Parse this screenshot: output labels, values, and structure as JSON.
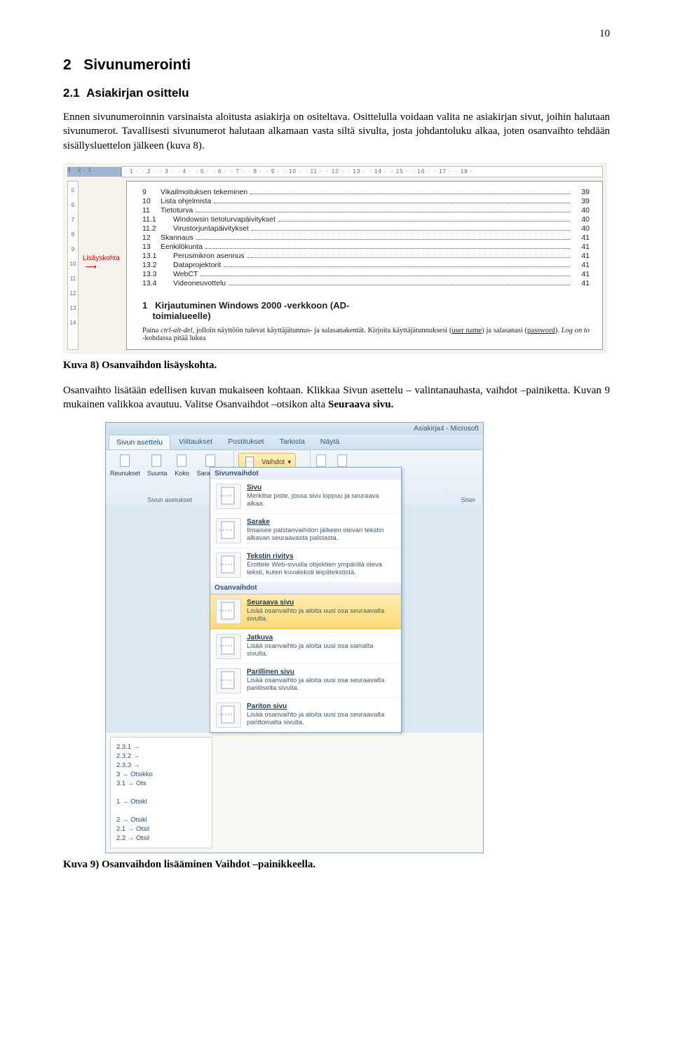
{
  "page_number": "10",
  "h1_num": "2",
  "h1_text": "Sivunumerointi",
  "h2_num": "2.1",
  "h2_text": "Asiakirjan osittelu",
  "p1_a": "Ennen sivunumeroinnin varsinaista aloitusta asiakirja on ositeltava. Osittelulla voidaan valita ne asiakirjan sivut, joihin halutaan sivunumerot. Tavallisesti sivunumerot halutaan alkamaan vasta siltä sivulta, josta johdantoluku alkaa, joten osanvaihto tehdään sisällysluettelon jälkeen (kuva 8).",
  "kuva8": {
    "ruler_left_vals": [
      "3",
      "2",
      "1"
    ],
    "ruler_right_vals": [
      "1",
      "2",
      "3",
      "4",
      "5",
      "6",
      "7",
      "8",
      "9",
      "10",
      "11",
      "12",
      "13",
      "14",
      "15",
      "16",
      "17",
      "18"
    ],
    "vruler_vals": [
      "5",
      "6",
      "7",
      "8",
      "9",
      "10",
      "11",
      "12",
      "13",
      "14"
    ],
    "lisayskohta_label": "Lisäyskohta",
    "toc": [
      {
        "num": "9",
        "sub": "",
        "title": "Vikailmoituksen tekeminen",
        "pg": "39"
      },
      {
        "num": "10",
        "sub": "",
        "title": "Lista ohjelmista",
        "pg": "39"
      },
      {
        "num": "11",
        "sub": "",
        "title": "Tietoturva",
        "pg": "40"
      },
      {
        "num": "",
        "sub": "11.1",
        "title": "Windowsin tietoturvapäivitykset",
        "pg": "40"
      },
      {
        "num": "",
        "sub": "11.2",
        "title": "Virustorjuntapäivitykset",
        "pg": "40"
      },
      {
        "num": "12",
        "sub": "",
        "title": "Skannaus",
        "pg": "41"
      },
      {
        "num": "13",
        "sub": "",
        "title": "Eenkilökunta",
        "pg": "41"
      },
      {
        "num": "",
        "sub": "13.1",
        "title": "Perusmikron asennus",
        "pg": "41"
      },
      {
        "num": "",
        "sub": "13.2",
        "title": "Dataprojektorit",
        "pg": "41"
      },
      {
        "num": "",
        "sub": "13.3",
        "title": "WebCT",
        "pg": "41"
      },
      {
        "num": "",
        "sub": "13.4",
        "title": "Videoneuvottelu",
        "pg": "41"
      }
    ],
    "sec_num": "1",
    "sec_head_a": "Kirjautuminen Windows 2000 -verkkoon (AD-",
    "sec_head_b": "toimialueelle)",
    "sec_body_a": "Paina ",
    "sec_body_i1": "ctrl-alt-del",
    "sec_body_b": ", jolloin näyttöön tulevat käyttäjätunnus- ja salasanakentät. Kirjoita käyttäjätunnuksesi (",
    "sec_body_u1": "user name",
    "sec_body_c": ") ja salasanasi (",
    "sec_body_u2": "password",
    "sec_body_d": "). ",
    "sec_body_i2": "Log on to",
    "sec_body_e": " -kohdassa pitää lukea"
  },
  "caption8_a": "Kuva 8) Osanvaihdon lisäyskohta.",
  "p2_a": "Osanvaihto lisätään edellisen kuvan mukaiseen kohtaan. Klikkaa Sivun asettelu – valintanauhasta, vaihdot –painiketta. Kuvan 9 mukainen valikkoa avautuu. Valitse Osanvaihdot –otsikon alta ",
  "p2_b": "Seuraava sivu.",
  "kuva9": {
    "title_suffix": "Asiakirja4 - Microsoft",
    "tabs": [
      "Sivun asettelu",
      "Viittaukset",
      "Postitukset",
      "Tarkista",
      "Näytä"
    ],
    "active_tab_index": 0,
    "grp1_btns": [
      "Reunukset",
      "Suunta",
      "Koko",
      "Sarakkeet"
    ],
    "grp1_label": "Sivun asetukset",
    "vaihdot_label": "Vaihdot",
    "siser_label": "Siser",
    "dd_head1": "Sivunvaihdot",
    "dd_head2": "Osanvaihdot",
    "items1": [
      {
        "title": "Sivu",
        "desc": "Merkitse piste, jossa sivu loppuu ja seuraava alkaa."
      },
      {
        "title": "Sarake",
        "desc": "Ilmaisee palstanvaihdon jälkeen olevan tekstin alkavan seuraavasta palstasta."
      },
      {
        "title": "Tekstin rivitys",
        "desc": "Erottele Web-sivuilla objektien ympärillä oleva teksti, kuten kuvateksti leipätekstistä."
      }
    ],
    "items2": [
      {
        "title": "Seuraava sivu",
        "desc": "Lisää osanvaihto ja aloita uusi osa seuraavalta sivulta.",
        "hl": true
      },
      {
        "title": "Jatkuva",
        "desc": "Lisää osanvaihto ja aloita uusi osa samalta sivulta."
      },
      {
        "title": "Parillinen sivu",
        "desc": "Lisää osanvaihto ja aloita uusi osa seuraavalta parilliselta sivulta."
      },
      {
        "title": "Pariton sivu",
        "desc": "Lisää osanvaihto ja aloita uusi osa seuraavalta parittomalta sivulta."
      }
    ],
    "navrows": [
      "2.3.1 →",
      "2.3.2 →",
      "2.3.3 →",
      "3 → Otsikko",
      "3.1 → Ots",
      "",
      "1 → Otsikl",
      "",
      "2 → Otsikl",
      "2.1 → Otsil",
      "2.2 → Otsil"
    ]
  },
  "caption9_a": "Kuva 9) Osanvaihdon lisääminen Vaihdot –painikkeella."
}
